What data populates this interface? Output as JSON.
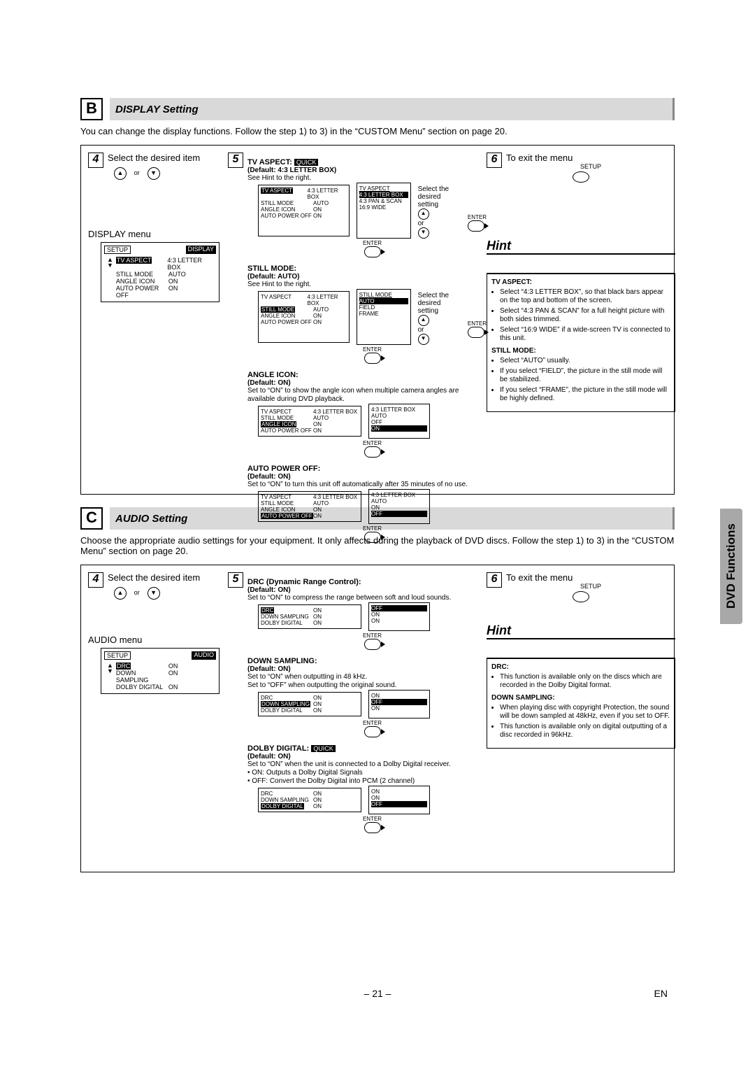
{
  "section_b": {
    "letter": "B",
    "title": "DISPLAY Setting",
    "intro": "You can change the display functions. Follow the step 1) to 3) in the “CUSTOM Menu” section on page 20.",
    "step4": {
      "num": "4",
      "title": "Select the desired item",
      "or_label": "or",
      "menu_header": "DISPLAY menu",
      "setup_label": "SETUP",
      "display_label": "DISPLAY",
      "rows": [
        {
          "k": "TV ASPECT",
          "v": "4:3 LETTER BOX",
          "sel": true
        },
        {
          "k": "STILL MODE",
          "v": "AUTO"
        },
        {
          "k": "ANGLE ICON",
          "v": "ON"
        },
        {
          "k": "AUTO POWER OFF",
          "v": "ON"
        }
      ]
    },
    "step5": {
      "num": "5",
      "select_text": "Select the desired setting",
      "or_label": "or",
      "enter_label": "ENTER",
      "items": [
        {
          "head": "TV ASPECT:",
          "quick": true,
          "default": "(Default: 4:3 LETTER BOX)",
          "text": "See Hint to the right.",
          "menu_sel": "TV ASPECT",
          "menu_rows": [
            {
              "k": "TV ASPECT",
              "v": "4:3 LETTER BOX",
              "sel": true
            },
            {
              "k": "STILL MODE",
              "v": "AUTO"
            },
            {
              "k": "ANGLE ICON",
              "v": "ON"
            },
            {
              "k": "AUTO POWER OFF",
              "v": "ON"
            }
          ],
          "options_head": "TV ASPECT",
          "options": [
            "4:3 LETTER BOX",
            "4:3 PAN & SCAN",
            "16:9 WIDE"
          ],
          "opt_sel": 0
        },
        {
          "head": "STILL MODE:",
          "default": "(Default: AUTO)",
          "text": "See Hint to the right.",
          "menu_sel": "STILL MODE",
          "menu_rows": [
            {
              "k": "TV ASPECT",
              "v": "4:3 LETTER BOX"
            },
            {
              "k": "STILL MODE",
              "v": "AUTO",
              "sel": true
            },
            {
              "k": "ANGLE ICON",
              "v": "ON"
            },
            {
              "k": "AUTO POWER OFF",
              "v": "ON"
            }
          ],
          "options_head": "STILL MODE",
          "options": [
            "AUTO",
            "FIELD",
            "FRAME"
          ],
          "opt_sel": 0
        },
        {
          "head": "ANGLE ICON:",
          "default": "(Default: ON)",
          "text": "Set to “ON” to show the angle icon when multiple camera angles are available during DVD playback.",
          "menu_sel": "ANGLE ICON",
          "menu_rows": [
            {
              "k": "TV ASPECT",
              "v": "4:3 LETTER BOX"
            },
            {
              "k": "STILL MODE",
              "v": "AUTO"
            },
            {
              "k": "ANGLE ICON",
              "v": "ON",
              "sel": true
            },
            {
              "k": "AUTO POWER OFF",
              "v": "ON"
            }
          ],
          "options_head2": "4:3 LETTER BOX",
          "options2": [
            "AUTO",
            "OFF",
            "ON"
          ],
          "opt_sel2": 2,
          "no_sel_box": true
        },
        {
          "head": "AUTO POWER OFF:",
          "default": "(Default: ON)",
          "text": "Set to “ON” to turn this unit off automatically after 35 minutes of no use.",
          "menu_sel": "AUTO POWER OFF",
          "menu_rows": [
            {
              "k": "TV ASPECT",
              "v": "4:3 LETTER BOX"
            },
            {
              "k": "STILL MODE",
              "v": "AUTO"
            },
            {
              "k": "ANGLE ICON",
              "v": "ON"
            },
            {
              "k": "AUTO POWER OFF",
              "v": "ON",
              "sel": true
            }
          ],
          "options_head2": "4:3 LETTER BOX",
          "options2": [
            "AUTO",
            "ON",
            "OFF"
          ],
          "opt_sel2": 2,
          "no_sel_box": true
        }
      ]
    },
    "step6": {
      "num": "6",
      "title": "To exit the menu",
      "setup_label": "SETUP"
    },
    "hint": {
      "title": "Hint",
      "tv_aspect": {
        "head": "TV ASPECT:",
        "bullets": [
          "Select “4:3 LETTER BOX”, so that black bars appear on the top and bottom of the screen.",
          "Select “4:3 PAN & SCAN” for a full height picture with both sides trimmed.",
          "Select “16:9 WIDE” if a wide-screen TV is connected to this unit."
        ]
      },
      "still_mode": {
        "head": "STILL MODE:",
        "bullets": [
          "Select “AUTO” usually.",
          "If you select “FIELD”, the picture in the still mode will be stabilized.",
          "If you select “FRAME”, the picture in the still mode will be highly defined."
        ]
      }
    }
  },
  "section_c": {
    "letter": "C",
    "title": "AUDIO Setting",
    "intro": "Choose the appropriate audio settings for your equipment. It only affects during the playback of DVD discs. Follow the step 1) to 3) in the “CUSTOM Menu” section on page 20.",
    "step4": {
      "num": "4",
      "title": "Select the desired item",
      "or_label": "or",
      "menu_header": "AUDIO menu",
      "setup_label": "SETUP",
      "display_label": "AUDIO",
      "rows": [
        {
          "k": "DRC",
          "v": "ON",
          "sel": true
        },
        {
          "k": "DOWN SAMPLING",
          "v": "ON"
        },
        {
          "k": "DOLBY DIGITAL",
          "v": "ON"
        }
      ]
    },
    "step5": {
      "num": "5",
      "enter_label": "ENTER",
      "items": [
        {
          "head": "DRC (Dynamic Range Control):",
          "default": "(Default: ON)",
          "text": "Set to “ON” to compress the range between soft and loud sounds.",
          "menu_rows": [
            {
              "k": "DRC",
              "v": "ON",
              "sel": true
            },
            {
              "k": "DOWN SAMPLING",
              "v": "ON"
            },
            {
              "k": "DOLBY DIGITAL",
              "v": "ON"
            }
          ],
          "options2": [
            "OFF",
            "ON",
            "ON"
          ],
          "opt_sel2": 0
        },
        {
          "head": "DOWN SAMPLING:",
          "default": "(Default: ON)",
          "text": "Set to “ON” when outputting in 48 kHz.",
          "text2": "Set to “OFF” when outputting the original sound.",
          "menu_rows": [
            {
              "k": "DRC",
              "v": "ON"
            },
            {
              "k": "DOWN SAMPLING",
              "v": "ON",
              "sel": true
            },
            {
              "k": "DOLBY DIGITAL",
              "v": "ON"
            }
          ],
          "options2": [
            "ON",
            "OFF",
            "ON"
          ],
          "opt_sel2": 1
        },
        {
          "head": "DOLBY DIGITAL:",
          "quick": true,
          "default": "(Default: ON)",
          "text": "Set to “ON” when the unit is connected to a Dolby Digital receiver.",
          "b1": "ON: Outputs a Dolby Digital Signals",
          "b2": "OFF: Convert the Dolby Digital into PCM (2 channel)",
          "menu_rows": [
            {
              "k": "DRC",
              "v": "ON"
            },
            {
              "k": "DOWN SAMPLING",
              "v": "ON"
            },
            {
              "k": "DOLBY DIGITAL",
              "v": "ON",
              "sel": true
            }
          ],
          "options2": [
            "ON",
            "ON",
            "OFF"
          ],
          "opt_sel2": 2
        }
      ]
    },
    "step6": {
      "num": "6",
      "title": "To exit the menu",
      "setup_label": "SETUP"
    },
    "hint": {
      "title": "Hint",
      "drc": {
        "head": "DRC:",
        "bullets": [
          "This function is available only on the discs which are recorded in the Dolby Digital format."
        ]
      },
      "down": {
        "head": "DOWN SAMPLING:",
        "bullets": [
          "When playing disc with copyright Protection, the sound will be down sampled at 48kHz, even if you set to OFF.",
          "This function is available only on digital outputting of a disc recorded in 96kHz."
        ]
      }
    }
  },
  "side_tab": "DVD Functions",
  "page_number": "– 21 –",
  "lang_code": "EN"
}
